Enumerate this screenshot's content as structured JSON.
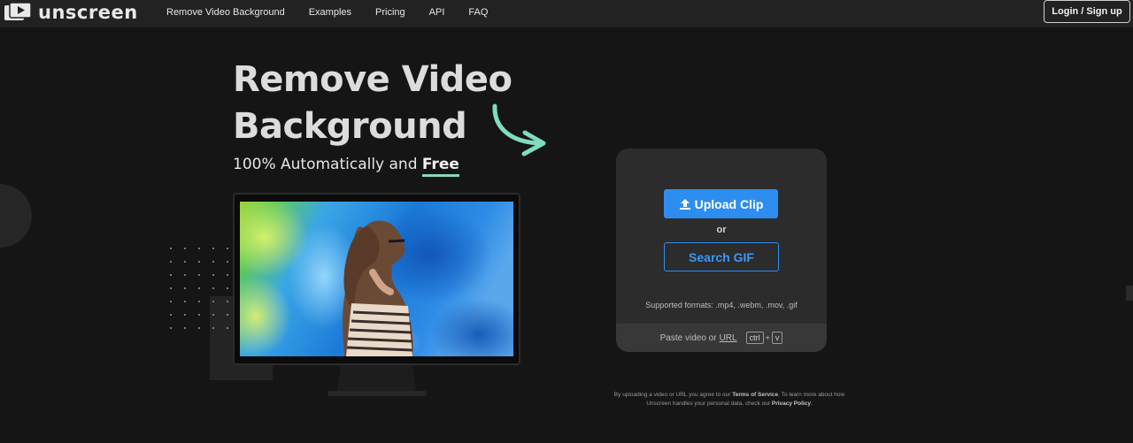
{
  "nav": {
    "logo_text": "unscreen",
    "links": [
      "Remove Video Background",
      "Examples",
      "Pricing",
      "API",
      "FAQ"
    ],
    "login_label": "Login / Sign up"
  },
  "hero": {
    "title": "Remove Video Background",
    "subtitle_prefix": "100% Automatically and ",
    "subtitle_highlight": "Free",
    "accent_color": "#80dcc0"
  },
  "upload": {
    "upload_label": "Upload Clip",
    "or_label": "or",
    "search_label": "Search GIF",
    "formats_text": "Supported formats: .mp4, .webm, .mov, .gif",
    "paste_prefix": "Paste video or",
    "paste_url": "URL",
    "key_ctrl": "ctrl",
    "key_plus": "+",
    "key_v": "v",
    "button_color": "#2e8ef0"
  },
  "terms": {
    "part1": "By uploading a video or URL you agree to our ",
    "tos": "Terms of Service",
    "part2": ". To learn more about how Unscreen handles your personal data, check our ",
    "privacy": "Privacy Policy",
    "part3": "."
  }
}
